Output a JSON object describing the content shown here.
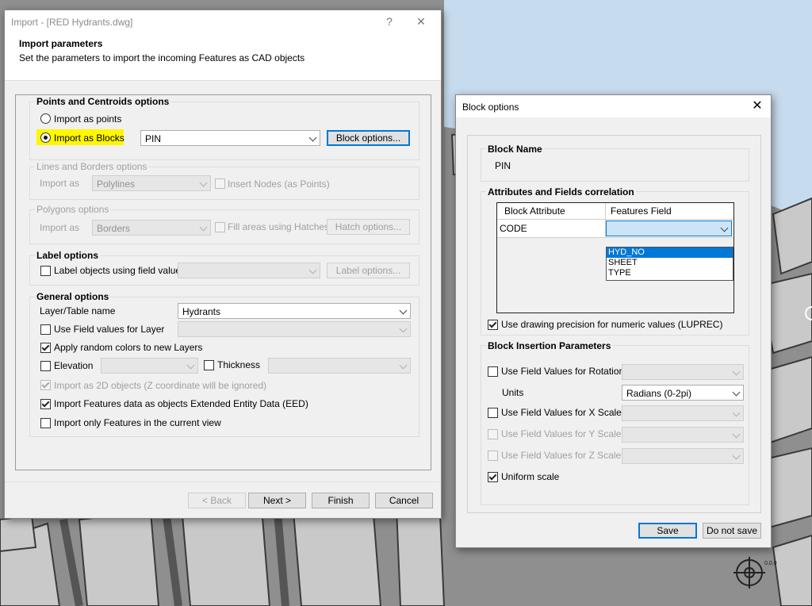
{
  "import_dialog": {
    "title": "Import - [RED Hydrants.dwg]",
    "help_icon": "question-mark-icon",
    "close_icon": "close-icon",
    "header_title": "Import parameters",
    "header_subtitle": "Set the parameters to import the incoming Features as CAD objects",
    "points": {
      "group_title": "Points and Centroids options",
      "import_as_points": "Import as points",
      "import_as_blocks": "Import as Blocks",
      "block_combo": "PIN",
      "block_options_button": "Block options...",
      "selected": "Import as Blocks"
    },
    "lines": {
      "group_title": "Lines and Borders options",
      "import_as_label": "Import as",
      "import_as_value": "Polylines",
      "insert_nodes": "Insert Nodes (as Points)"
    },
    "polygons": {
      "group_title": "Polygons options",
      "import_as_label": "Import as",
      "import_as_value": "Borders",
      "fill_areas": "Fill areas using Hatches",
      "hatch_options_button": "Hatch options..."
    },
    "label": {
      "group_title": "Label options",
      "label_objects": "Label objects using field value",
      "label_options_button": "Label options..."
    },
    "general": {
      "group_title": "General options",
      "layer_table_label": "Layer/Table name",
      "layer_table_value": "Hydrants",
      "use_field_values_layer": "Use Field values for Layer",
      "apply_random_colors": "Apply random colors to new Layers",
      "elevation": "Elevation",
      "thickness": "Thickness",
      "import_as_2d": "Import as 2D objects (Z coordinate will be ignored)",
      "import_eed": "Import Features data as objects Extended Entity Data (EED)",
      "import_current_view": "Import only Features in the current view"
    },
    "footer": {
      "back": "< Back",
      "next": "Next >",
      "finish": "Finish",
      "cancel": "Cancel"
    }
  },
  "block_dialog": {
    "title": "Block options",
    "close_icon": "close-icon",
    "block_name_title": "Block Name",
    "block_name_value": "PIN",
    "attributes_title": "Attributes and Fields correlation",
    "table_headers": [
      "Block Attribute",
      "Features Field"
    ],
    "table_rows": [
      {
        "attribute": "CODE",
        "field": ""
      }
    ],
    "dropdown_options": [
      "HYD_NO",
      "SHEET",
      "TYPE"
    ],
    "dropdown_highlighted": "HYD_NO",
    "use_drawing_precision": "Use drawing precision for numeric values (LUPREC)",
    "insertion_title": "Block Insertion Parameters",
    "use_field_rotation": "Use Field Values for Rotation",
    "units_label": "Units",
    "units_value": "Radians (0-2pi)",
    "use_field_x_scale": "Use Field Values for X Scale",
    "use_field_y_scale": "Use Field Values for Y Scale",
    "use_field_z_scale": "Use Field Values for Z Scale",
    "uniform_scale": "Uniform scale",
    "save": "Save",
    "do_not_save": "Do not save"
  },
  "cad_background": {
    "coordinate_label": "0,0,0"
  },
  "colors": {
    "highlight": "#fff700",
    "selection": "#0078d7",
    "combo_active": "#cce4f7",
    "cad_gray": "#8f8f8f",
    "cad_blue": "#c7dbee"
  }
}
